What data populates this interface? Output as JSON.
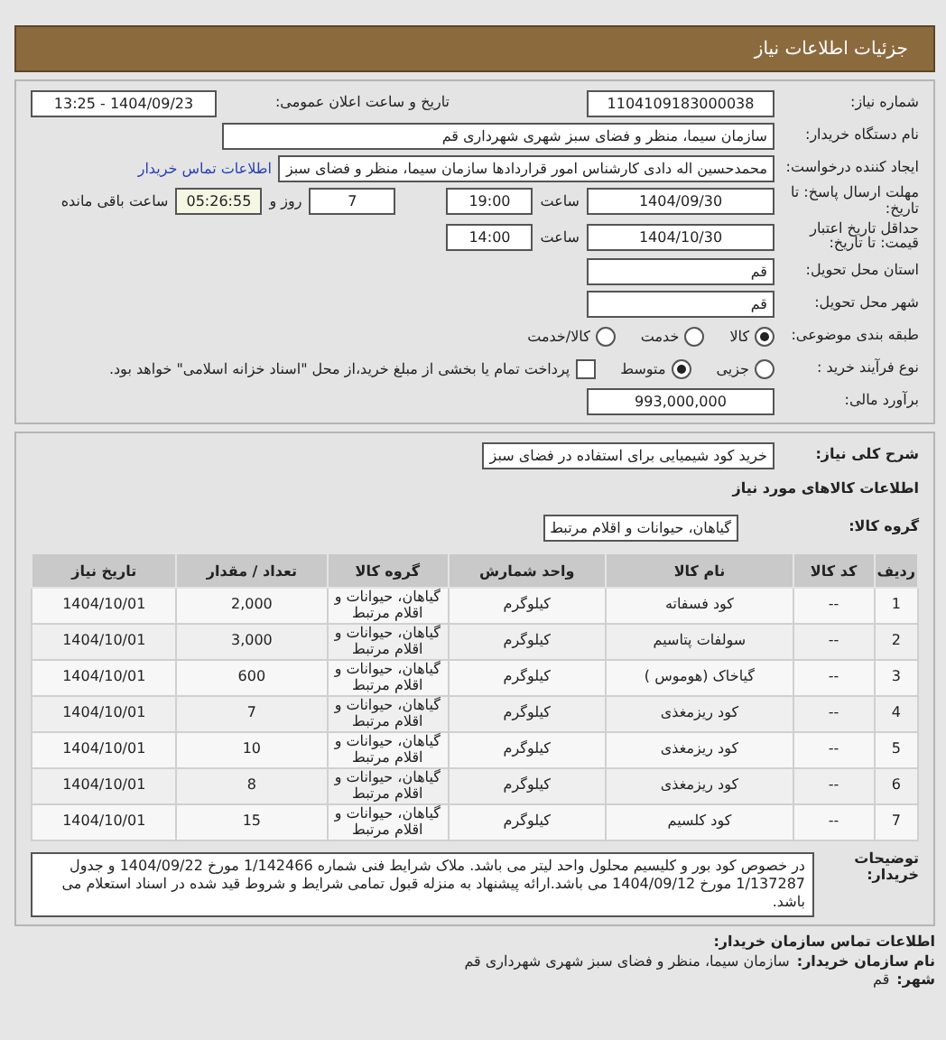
{
  "header": {
    "title": "جزئیات اطلاعات نیاز"
  },
  "need_number": {
    "label": "شماره نیاز:",
    "value": "1104109183000038"
  },
  "announce": {
    "label": "تاریخ و ساعت اعلان عمومی:",
    "value": "1404/09/23 - 13:25"
  },
  "buyer": {
    "label": "نام دستگاه خریدار:",
    "value": "سازمان سیما، منظر و فضای سبز شهری شهرداری قم"
  },
  "creator": {
    "label": "ایجاد کننده درخواست:",
    "value": "محمدحسین اله دادی کارشناس امور قراردادها سازمان سیما، منظر و فضای سبز",
    "link": "اطلاعات تماس خریدار"
  },
  "deadline": {
    "label": "مهلت ارسال پاسخ: تا تاریخ:",
    "date": "1404/09/30",
    "time_label": "ساعت",
    "time": "19:00",
    "days": "7",
    "days_label": "روز و",
    "remaining": "05:26:55",
    "remaining_label": "ساعت باقی مانده"
  },
  "validity": {
    "label": "حداقل تاریخ اعتبار قیمت: تا تاریخ:",
    "date": "1404/10/30",
    "time_label": "ساعت",
    "time": "14:00"
  },
  "province": {
    "label": "استان محل تحویل:",
    "value": "قم"
  },
  "city": {
    "label": "شهر محل تحویل:",
    "value": "قم"
  },
  "category": {
    "label": "طبقه بندی موضوعی:",
    "options": [
      {
        "label": "کالا",
        "selected": true
      },
      {
        "label": "خدمت",
        "selected": false
      },
      {
        "label": "کالا/خدمت",
        "selected": false
      }
    ]
  },
  "process": {
    "label": "نوع فرآیند خرید :",
    "options": [
      {
        "label": "جزیی",
        "selected": false
      },
      {
        "label": "متوسط",
        "selected": true
      }
    ],
    "payment": {
      "label": "پرداخت تمام یا بخشی از مبلغ خرید،از محل \"اسناد خزانه اسلامی\" خواهد بود.",
      "checked": false
    }
  },
  "estimate": {
    "label": "برآورد مالی:",
    "value": "993,000,000"
  },
  "summary": {
    "label": "شرح کلی نیاز:",
    "value": "خرید کود شیمیایی برای استفاده در فضای سبز"
  },
  "goods_heading": "اطلاعات کالاهای مورد نیاز",
  "goods_group": {
    "label": "گروه کالا:",
    "value": "گیاهان، حیوانات و اقلام مرتبط"
  },
  "table": {
    "columns": [
      "ردیف",
      "کد کالا",
      "نام کالا",
      "واحد شمارش",
      "گروه کالا",
      "تعداد / مقدار",
      "تاریخ نیاز"
    ],
    "rows": [
      [
        "1",
        "--",
        "کود فسفاته",
        "کیلوگرم",
        "گیاهان، حیوانات و اقلام مرتبط",
        "2,000",
        "1404/10/01"
      ],
      [
        "2",
        "--",
        "سولفات پتاسیم",
        "کیلوگرم",
        "گیاهان، حیوانات و اقلام مرتبط",
        "3,000",
        "1404/10/01"
      ],
      [
        "3",
        "--",
        "گیاخاک (هوموس )",
        "کیلوگرم",
        "گیاهان، حیوانات و اقلام مرتبط",
        "600",
        "1404/10/01"
      ],
      [
        "4",
        "--",
        "کود ریزمغذی",
        "کیلوگرم",
        "گیاهان، حیوانات و اقلام مرتبط",
        "7",
        "1404/10/01"
      ],
      [
        "5",
        "--",
        "کود ریزمغذی",
        "کیلوگرم",
        "گیاهان، حیوانات و اقلام مرتبط",
        "10",
        "1404/10/01"
      ],
      [
        "6",
        "--",
        "کود ریزمغذی",
        "کیلوگرم",
        "گیاهان، حیوانات و اقلام مرتبط",
        "8",
        "1404/10/01"
      ],
      [
        "7",
        "--",
        "کود کلسیم",
        "کیلوگرم",
        "گیاهان، حیوانات و اقلام مرتبط",
        "15",
        "1404/10/01"
      ]
    ]
  },
  "notes": {
    "label": "توضیحات خریدار:",
    "value": "در خصوص کود بور و کلیسیم محلول واحد لیتر می باشد. ملاک شرایط فنی شماره 1/142466 مورخ 1404/09/22 و جدول 1/137287 مورخ 1404/09/12 می باشد.ارائه پیشنهاد به منزله قبول تمامی شرایط و شروط قید شده در اسناد استعلام می باشد."
  },
  "contact": {
    "title": "اطلاعات تماس سازمان خریدار:",
    "org_label": "نام سازمان خریدار:",
    "org": "سازمان سیما، منظر و فضای سبز شهری شهرداری قم",
    "city_label": "شهر:",
    "city": "قم"
  }
}
